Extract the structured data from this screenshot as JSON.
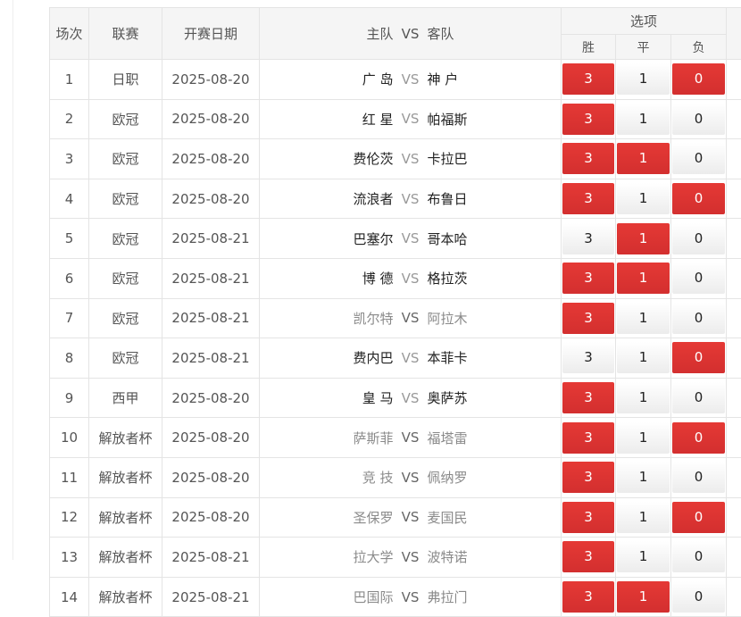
{
  "headers": {
    "match_no": "场次",
    "league": "联赛",
    "date": "开赛日期",
    "home": "主队",
    "vs": "VS",
    "away": "客队",
    "options": "选项",
    "win": "胜",
    "draw": "平",
    "lose": "负"
  },
  "rows": [
    {
      "no": "1",
      "league": "日职",
      "date": "2025-08-20",
      "home": "广 岛",
      "away": "神 户",
      "muted": false,
      "win": "3",
      "draw": "1",
      "lose": "0",
      "sel": [
        true,
        false,
        true
      ]
    },
    {
      "no": "2",
      "league": "欧冠",
      "date": "2025-08-20",
      "home": "红 星",
      "away": "帕福斯",
      "muted": false,
      "win": "3",
      "draw": "1",
      "lose": "0",
      "sel": [
        true,
        false,
        false
      ]
    },
    {
      "no": "3",
      "league": "欧冠",
      "date": "2025-08-20",
      "home": "费伦茨",
      "away": "卡拉巴",
      "muted": false,
      "win": "3",
      "draw": "1",
      "lose": "0",
      "sel": [
        true,
        true,
        false
      ]
    },
    {
      "no": "4",
      "league": "欧冠",
      "date": "2025-08-20",
      "home": "流浪者",
      "away": "布鲁日",
      "muted": false,
      "win": "3",
      "draw": "1",
      "lose": "0",
      "sel": [
        true,
        false,
        true
      ]
    },
    {
      "no": "5",
      "league": "欧冠",
      "date": "2025-08-21",
      "home": "巴塞尔",
      "away": "哥本哈",
      "muted": false,
      "win": "3",
      "draw": "1",
      "lose": "0",
      "sel": [
        false,
        true,
        false
      ]
    },
    {
      "no": "6",
      "league": "欧冠",
      "date": "2025-08-21",
      "home": "博 德",
      "away": "格拉茨",
      "muted": false,
      "win": "3",
      "draw": "1",
      "lose": "0",
      "sel": [
        true,
        true,
        false
      ]
    },
    {
      "no": "7",
      "league": "欧冠",
      "date": "2025-08-21",
      "home": "凯尔特",
      "away": "阿拉木",
      "muted": true,
      "win": "3",
      "draw": "1",
      "lose": "0",
      "sel": [
        true,
        false,
        false
      ]
    },
    {
      "no": "8",
      "league": "欧冠",
      "date": "2025-08-21",
      "home": "费内巴",
      "away": "本菲卡",
      "muted": false,
      "win": "3",
      "draw": "1",
      "lose": "0",
      "sel": [
        false,
        false,
        true
      ]
    },
    {
      "no": "9",
      "league": "西甲",
      "date": "2025-08-20",
      "home": "皇 马",
      "away": "奥萨苏",
      "muted": false,
      "win": "3",
      "draw": "1",
      "lose": "0",
      "sel": [
        true,
        false,
        false
      ]
    },
    {
      "no": "10",
      "league": "解放者杯",
      "date": "2025-08-20",
      "home": "萨斯菲",
      "away": "福塔雷",
      "muted": true,
      "win": "3",
      "draw": "1",
      "lose": "0",
      "sel": [
        true,
        false,
        true
      ]
    },
    {
      "no": "11",
      "league": "解放者杯",
      "date": "2025-08-20",
      "home": "竞 技",
      "away": "佩纳罗",
      "muted": true,
      "win": "3",
      "draw": "1",
      "lose": "0",
      "sel": [
        true,
        false,
        false
      ]
    },
    {
      "no": "12",
      "league": "解放者杯",
      "date": "2025-08-20",
      "home": "圣保罗",
      "away": "麦国民",
      "muted": true,
      "win": "3",
      "draw": "1",
      "lose": "0",
      "sel": [
        true,
        false,
        true
      ]
    },
    {
      "no": "13",
      "league": "解放者杯",
      "date": "2025-08-21",
      "home": "拉大学",
      "away": "波特诺",
      "muted": true,
      "win": "3",
      "draw": "1",
      "lose": "0",
      "sel": [
        true,
        false,
        false
      ]
    },
    {
      "no": "14",
      "league": "解放者杯",
      "date": "2025-08-21",
      "home": "巴国际",
      "away": "弗拉门",
      "muted": true,
      "win": "3",
      "draw": "1",
      "lose": "0",
      "sel": [
        true,
        true,
        false
      ]
    }
  ],
  "colors": {
    "selected": "#e53935",
    "unselected": "#f3f3f3"
  }
}
